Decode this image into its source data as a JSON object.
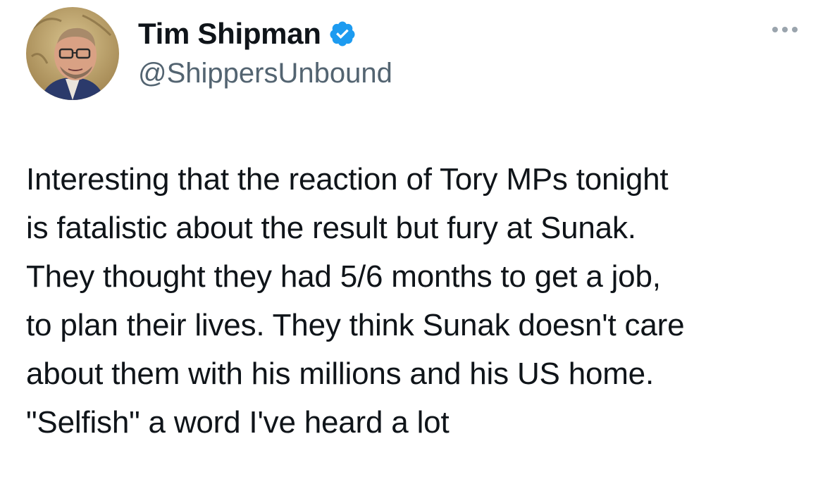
{
  "author": {
    "display_name": "Tim Shipman",
    "handle": "@ShippersUnbound",
    "verified": true,
    "verified_icon": "verified-badge-icon"
  },
  "more_menu_icon": "more-options-icon",
  "tweet": {
    "lines": [
      "Interesting that the reaction of Tory MPs tonight",
      "is fatalistic about the result but fury at Sunak.",
      "They thought they had 5/6 months to get a job,",
      "to plan their lives. They think Sunak doesn't care",
      "about them with his millions and his US home.",
      "\"Selfish\" a word I've heard a lot"
    ]
  },
  "colors": {
    "text": "#0f1419",
    "secondary": "#536471",
    "verified_blue": "#1d9bf0",
    "background": "#ffffff"
  }
}
